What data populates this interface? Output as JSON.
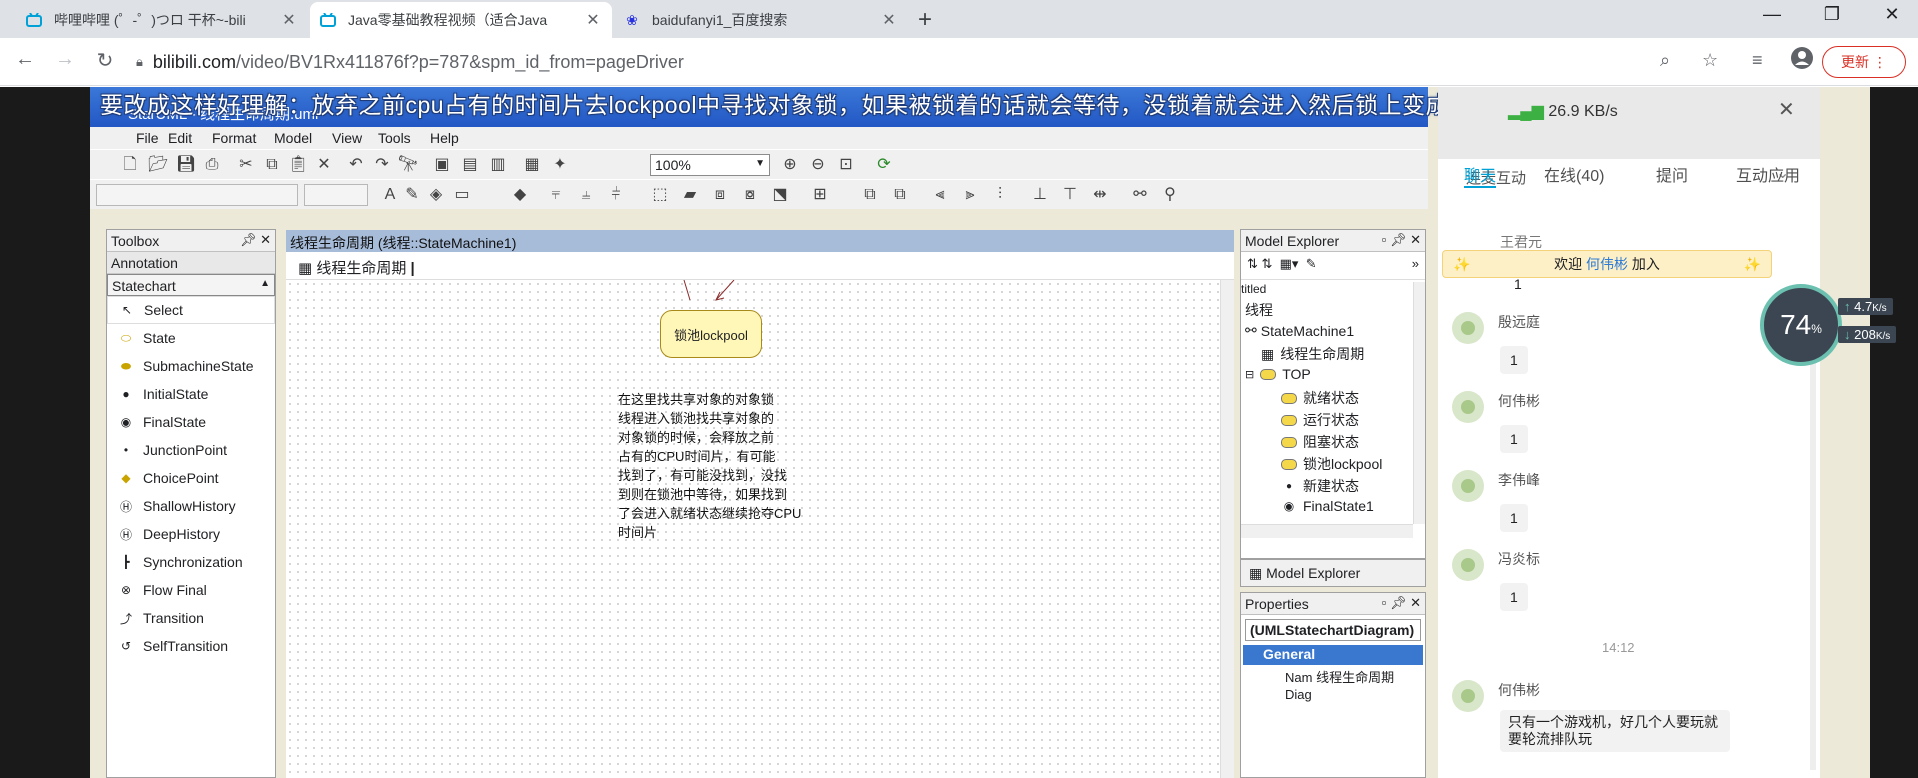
{
  "browser": {
    "tabs": [
      {
        "title": "哔哩哔哩 (゜-゜)つロ 干杯~-bili",
        "active": false
      },
      {
        "title": "Java零基础教程视频（适合Java",
        "active": true
      },
      {
        "title": "baidufanyi1_百度搜索",
        "active": false
      }
    ],
    "url_host": "bilibili.com",
    "url_path": "/video/BV1Rx411876f?p=787&spm_id_from=pageDriver",
    "update_label": "更新"
  },
  "video": {
    "subtitle": "要改成这样好理解：放弃之前cpu占有的时间片去lockpool中寻找对象锁，如果被锁着的话就会等待，没锁着就会进入然后锁上变成就绪状态。"
  },
  "staruml": {
    "window_title": "StarUML - 线程生命周期.uml",
    "menu": [
      "File",
      "Edit",
      "Format",
      "Model",
      "View",
      "Tools",
      "Help"
    ],
    "zoom": "100%",
    "toolbox": {
      "title": "Toolbox",
      "groups": [
        "Annotation",
        "Statechart"
      ],
      "tools": [
        "Select",
        "State",
        "SubmachineState",
        "InitialState",
        "FinalState",
        "JunctionPoint",
        "ChoicePoint",
        "ShallowHistory",
        "DeepHistory",
        "Synchronization",
        "Flow Final",
        "Transition",
        "SelfTransition"
      ]
    },
    "diagram": {
      "header": "线程生命周期 (线程::StateMachine1)",
      "tab": "线程生命周期",
      "state_label": "锁池lockpool",
      "note_lines": [
        "在这里找共享对象的对象锁",
        "线程进入锁池找共享对象的",
        "对象锁的时候，会释放之前",
        "占有的CPU时间片，有可能",
        "找到了，有可能没找到，没找",
        "到则在锁池中等待，如果找到",
        "了会进入就绪状态继续抢夺CPU",
        "时间片"
      ]
    },
    "explorer": {
      "title": "Model Explorer",
      "items": [
        "titled",
        "线程",
        "StateMachine1",
        "线程生命周期",
        "TOP",
        "就绪状态",
        "运行状态",
        "阻塞状态",
        "锁池lockpool",
        "新建状态",
        "FinalState1"
      ],
      "tab_label": "Model Explorer"
    },
    "properties": {
      "title": "Properties",
      "class_name": "(UMLStatechartDiagram)",
      "group": "General",
      "rows": [
        {
          "key": "Nam",
          "value": "线程生命周期"
        },
        {
          "key": "Diag",
          "value": ""
        }
      ]
    }
  },
  "chat": {
    "net_speed": "26.9 KB/s",
    "section": "连麦互动",
    "tabs": [
      "聊天",
      "在线(40)",
      "提问",
      "互动应用"
    ],
    "partial_user": "王君元",
    "banner_prefix": "欢迎",
    "banner_user": "何伟彬",
    "banner_suffix": "加入",
    "messages": [
      {
        "user": "殷远庭",
        "text": "1"
      },
      {
        "user": "何伟彬",
        "text": "1"
      },
      {
        "user": "李伟峰",
        "text": "1"
      },
      {
        "user": "冯炎标",
        "text": "1"
      }
    ],
    "time": "14:12",
    "last_user": "何伟彬",
    "last_text": "只有一个游戏机，好几个人要玩就要轮流排队玩",
    "speed_percent": "74",
    "up_rate": "4.7",
    "down_rate": "208",
    "rate_unit": "K/s"
  }
}
